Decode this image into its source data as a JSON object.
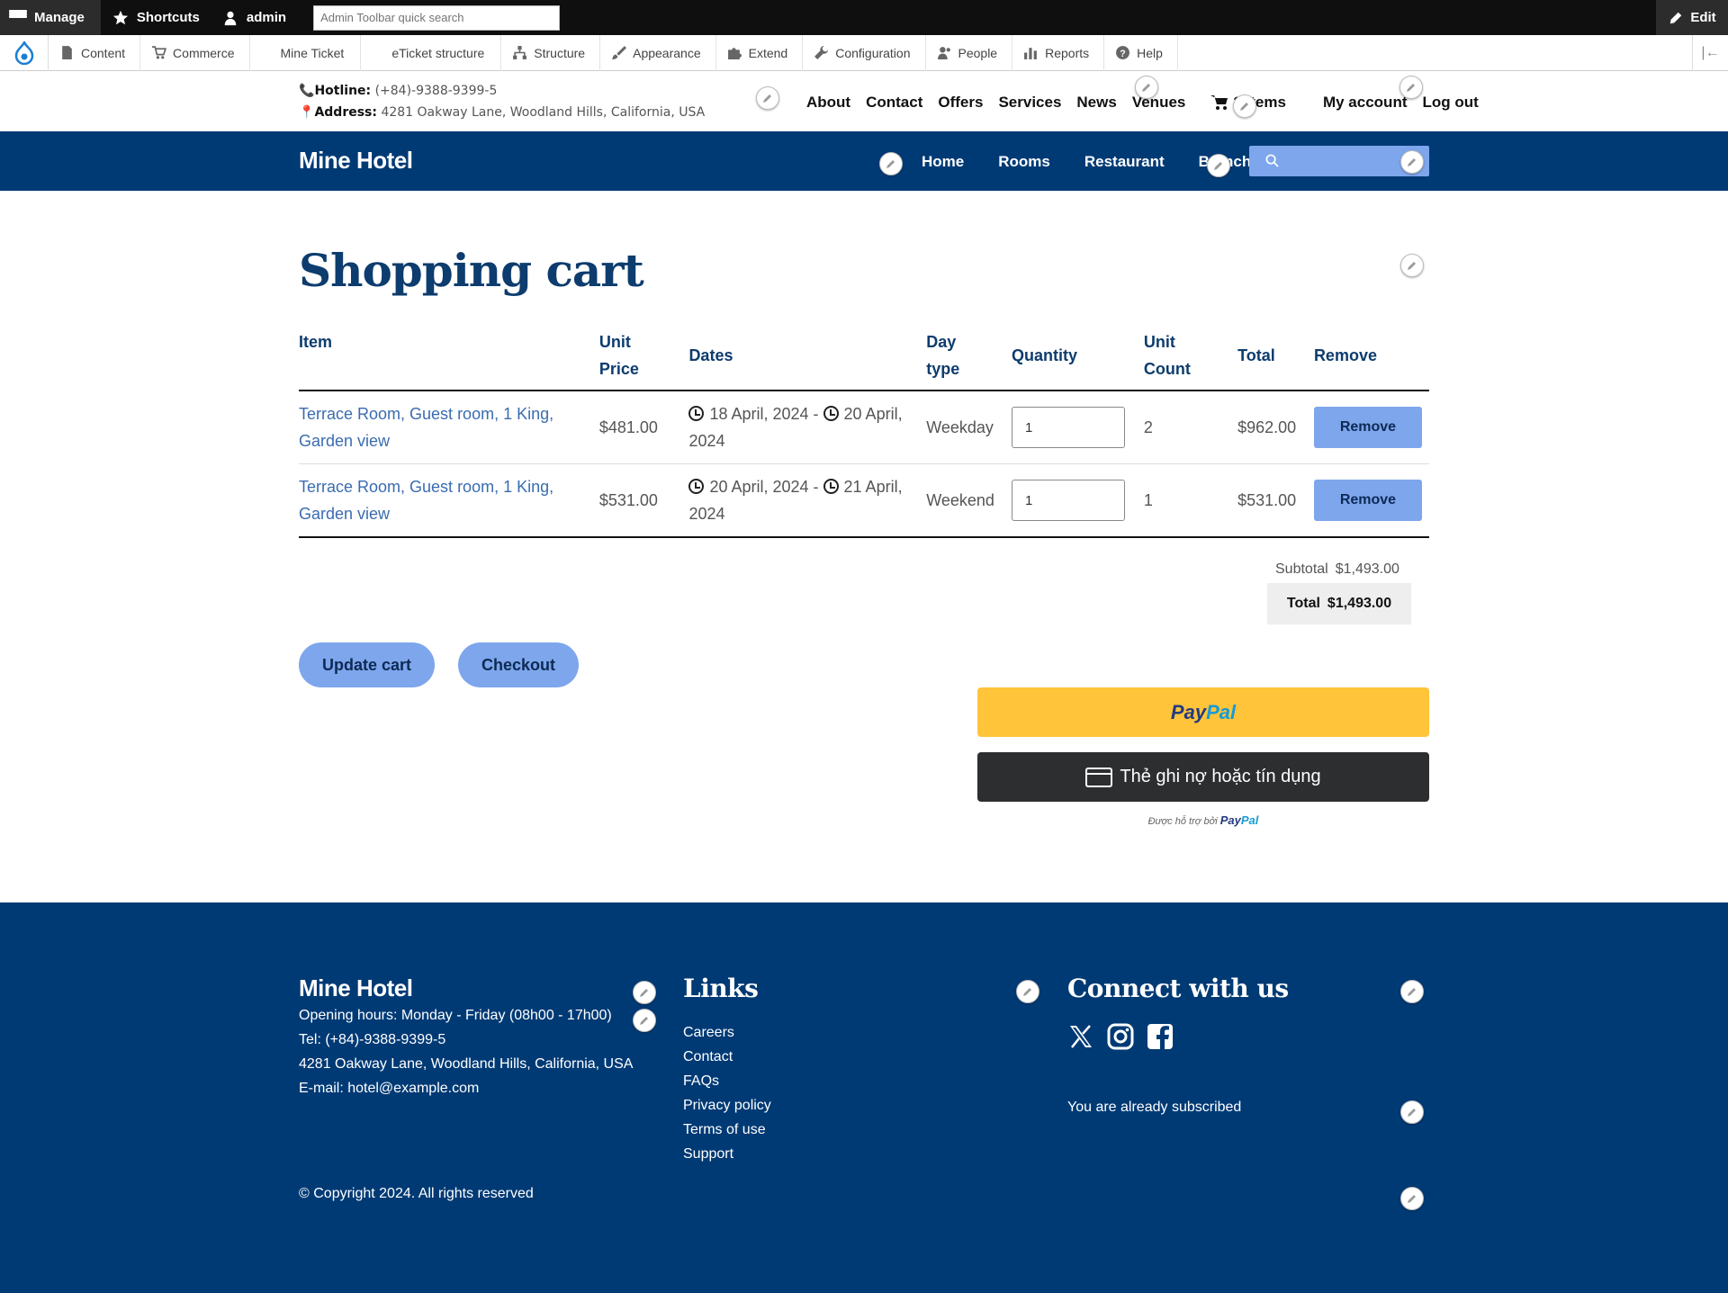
{
  "admin_toolbar": {
    "manage": "Manage",
    "shortcuts": "Shortcuts",
    "user": "admin",
    "search_placeholder": "Admin Toolbar quick search",
    "edit": "Edit"
  },
  "admin_tray": {
    "items": [
      "Content",
      "Commerce",
      "Mine Ticket",
      "eTicket structure",
      "Structure",
      "Appearance",
      "Extend",
      "Configuration",
      "People",
      "Reports",
      "Help"
    ]
  },
  "topbar": {
    "hotline_label": "Hotline:",
    "hotline": "(+84)-9388-9399-5",
    "address_label": "Address:",
    "address": "4281 Oakway Lane, Woodland Hills, California, USA",
    "nav": [
      "About",
      "Contact",
      "Offers",
      "Services",
      "News",
      "Venues"
    ],
    "cart": "2 items",
    "account": "My account",
    "logout": "Log out"
  },
  "header": {
    "brand": "Mine Hotel",
    "nav": [
      "Home",
      "Rooms",
      "Restaurant",
      "Branches"
    ]
  },
  "cart": {
    "title": "Shopping cart",
    "columns": {
      "item": "Item",
      "unit_price_1": "Unit",
      "unit_price_2": "Price",
      "dates": "Dates",
      "day_type_1": "Day",
      "day_type_2": "type",
      "quantity": "Quantity",
      "unit_count_1": "Unit",
      "unit_count_2": "Count",
      "total": "Total",
      "remove": "Remove"
    },
    "rows": [
      {
        "item": "Terrace Room, Guest room, 1 King, Garden view",
        "unit_price": "$481.00",
        "date_from": "18 April, 2024 -",
        "date_to": "20 April, 2024",
        "day_type": "Weekday",
        "quantity": "1",
        "unit_count": "2",
        "total": "$962.00",
        "remove": "Remove"
      },
      {
        "item": "Terrace Room, Guest room, 1 King, Garden view",
        "unit_price": "$531.00",
        "date_from": "20 April, 2024 -",
        "date_to": "21 April, 2024",
        "day_type": "Weekend",
        "quantity": "1",
        "unit_count": "1",
        "total": "$531.00",
        "remove": "Remove"
      }
    ],
    "subtotal_label": "Subtotal",
    "subtotal": "$1,493.00",
    "total_label": "Total",
    "total": "$1,493.00",
    "update_button": "Update cart",
    "checkout_button": "Checkout"
  },
  "paypal": {
    "button_part1": "Pay",
    "button_part2": "Pal",
    "card_button": "Thẻ ghi nợ hoặc tín dụng",
    "powered_by": "Được hỗ trợ bởi",
    "powered_brand_1": "Pay",
    "powered_brand_2": "Pal"
  },
  "footer": {
    "brand": "Mine Hotel",
    "hours": "Opening hours: Monday - Friday (08h00 - 17h00)",
    "tel": "Tel: (+84)-9388-9399-5",
    "address": "4281 Oakway Lane, Woodland Hills, California, USA",
    "email": "E-mail: hotel@example.com",
    "links_heading": "Links",
    "links": [
      "Careers",
      "Contact",
      "FAQs",
      "Privacy policy",
      "Terms of use",
      "Support"
    ],
    "connect_heading": "Connect with us",
    "social_icons": [
      "x-icon",
      "instagram-icon",
      "facebook-icon"
    ],
    "subscribed": "You are already subscribed",
    "copyright": "© Copyright 2024. All rights reserved"
  },
  "colors": {
    "brand_blue": "#003a75",
    "accent_blue": "#7ea6ec",
    "paypal_yellow": "#ffc43a",
    "heading_blue": "#0d3c6e"
  }
}
